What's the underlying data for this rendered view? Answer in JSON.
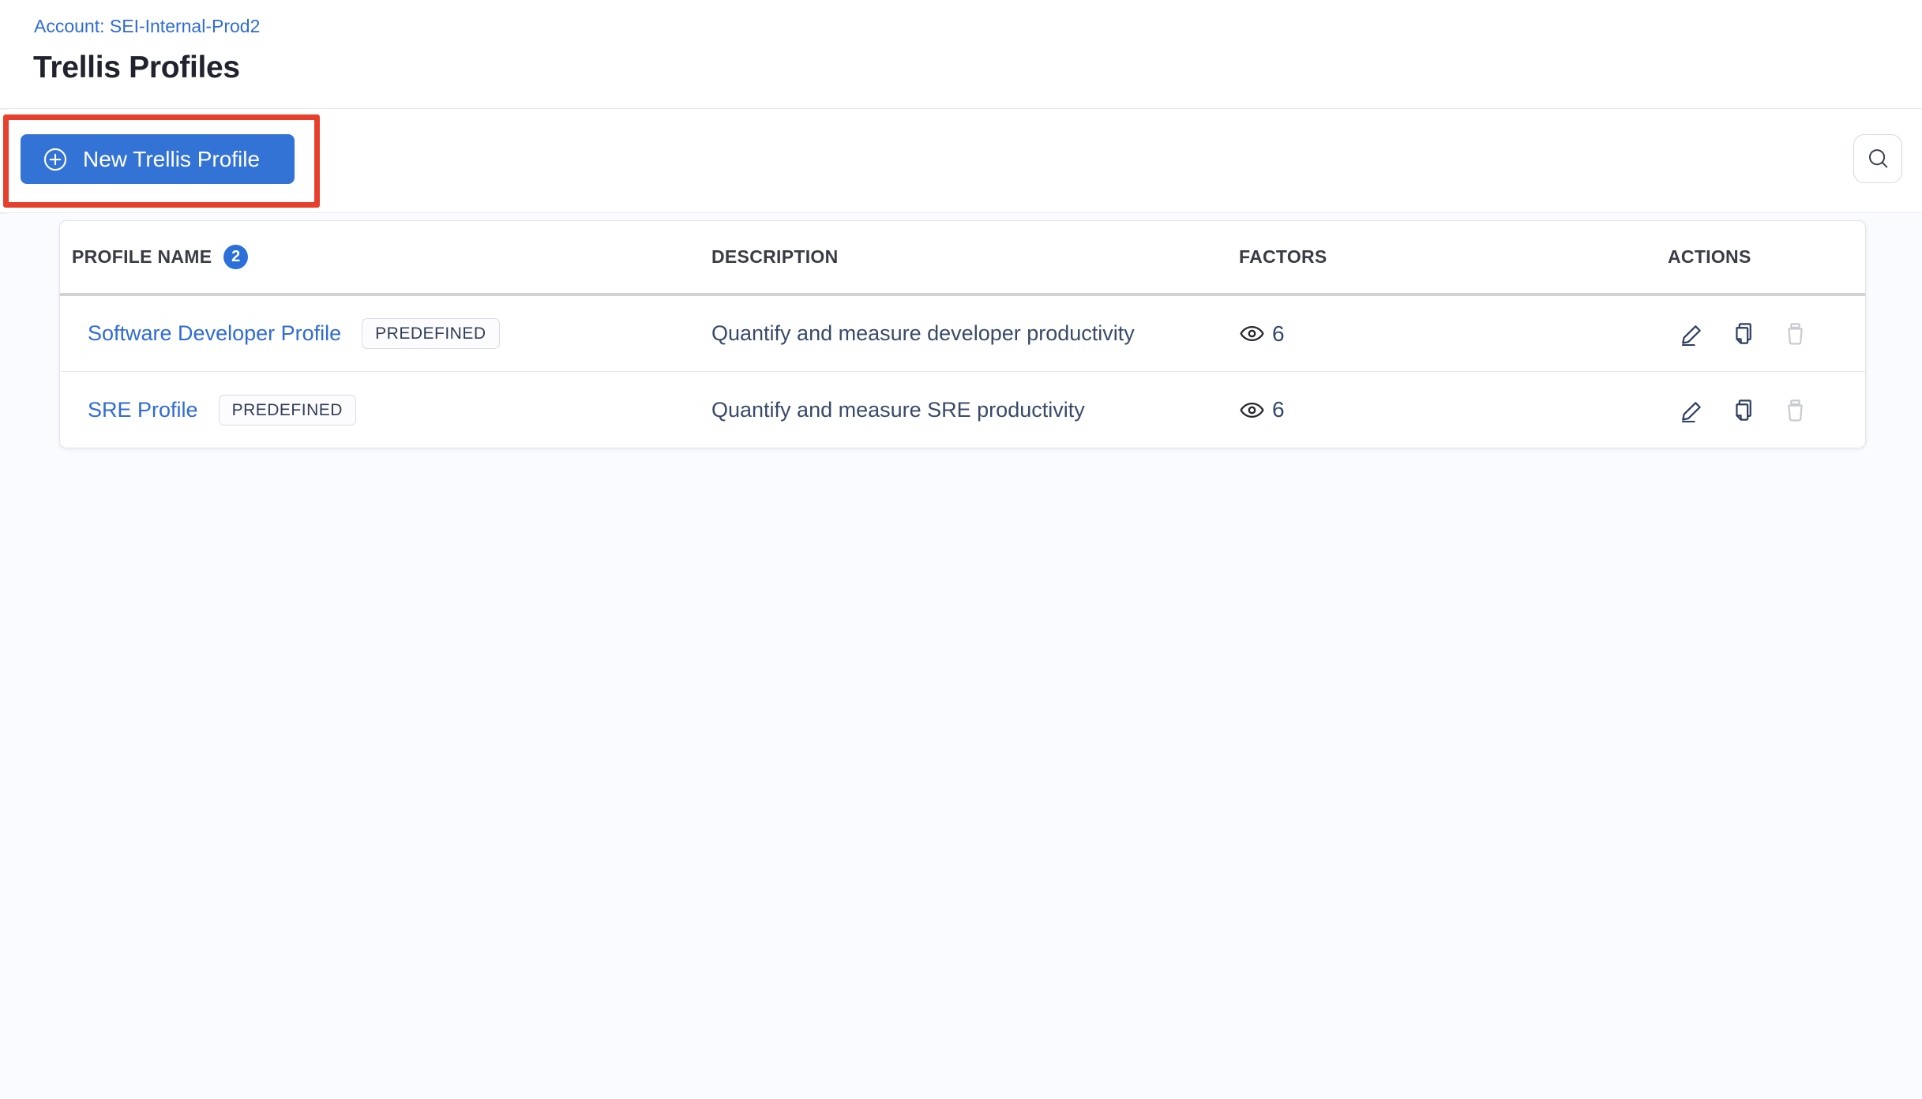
{
  "page": {
    "breadcrumb": "Account: SEI-Internal-Prod2",
    "title": "Trellis Profiles"
  },
  "toolbar": {
    "new_profile_button": "New Trellis Profile",
    "annotation": {
      "type": "highlight-rectangle",
      "color": "#e6402c"
    }
  },
  "table": {
    "headers": {
      "profile_name": "PROFILE NAME",
      "count_badge": "2",
      "description": "DESCRIPTION",
      "factors": "FACTORS",
      "actions": "ACTIONS"
    },
    "rows": [
      {
        "name": "Software Developer Profile",
        "tag": "PREDEFINED",
        "description": "Quantify and measure developer productivity",
        "factors": "6"
      },
      {
        "name": "SRE Profile",
        "tag": "PREDEFINED",
        "description": "Quantify and measure SRE productivity",
        "factors": "6"
      }
    ]
  },
  "icons": {
    "button_icon": "plus-circle-icon",
    "search": "search-icon",
    "factors": "eye-icon",
    "actions": [
      "edit-icon",
      "copy-icon",
      "delete-icon"
    ]
  },
  "colors": {
    "primary_blue": "#3373d6",
    "link_blue": "#2f6bd6",
    "badge_blue": "#2b6fd8",
    "annotation_red": "#e6402c",
    "title_text": "#20222e",
    "body_navy": "#394a68",
    "action_icon_navy": "#2d3d5f",
    "disabled_gray": "#c8cacf",
    "content_background": "#fafbfe"
  }
}
